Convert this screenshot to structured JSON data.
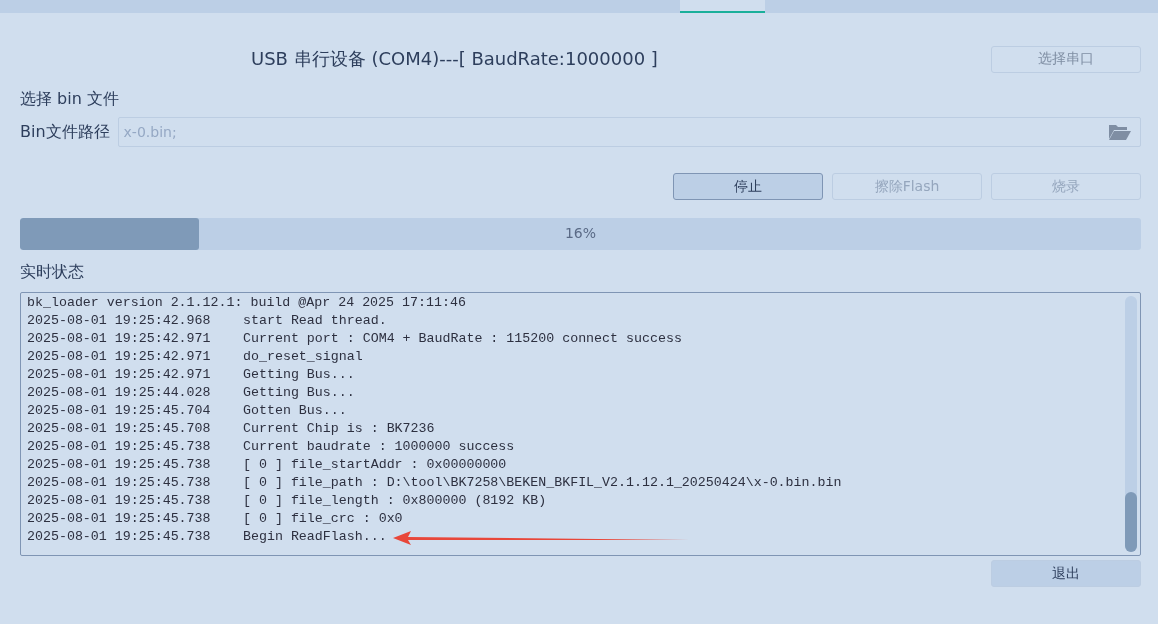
{
  "tabs": [
    {
      "selected": false
    },
    {
      "selected": true
    },
    {
      "selected": false
    }
  ],
  "device": {
    "title": "USB 串行设备 (COM4)---[ BaudRate:1000000 ]",
    "button": "选择串口"
  },
  "bin_section": {
    "heading": "选择 bin 文件",
    "path_label": "Bin文件路径",
    "path_value": "x-0.bin;"
  },
  "actions": [
    {
      "label": "停止",
      "disabled": false
    },
    {
      "label": "擦除Flash",
      "disabled": true
    },
    {
      "label": "烧录",
      "disabled": true
    }
  ],
  "progress": {
    "level": 0.16,
    "text": "16%"
  },
  "status": {
    "heading": "实时状态",
    "header_line": "bk_loader version 2.1.12.1: build @Apr 24 2025 17:11:46",
    "entries": [
      {
        "time": "2025-08-01 19:25:42.968",
        "message": "start Read thread."
      },
      {
        "time": "2025-08-01 19:25:42.971",
        "message": "Current port : COM4 + BaudRate : 115200 connect success"
      },
      {
        "time": "2025-08-01 19:25:42.971",
        "message": "do_reset_signal"
      },
      {
        "time": "2025-08-01 19:25:42.971",
        "message": "Getting Bus..."
      },
      {
        "time": "2025-08-01 19:25:44.028",
        "message": "Getting Bus..."
      },
      {
        "time": "2025-08-01 19:25:45.704",
        "message": "Gotten Bus..."
      },
      {
        "time": "2025-08-01 19:25:45.708",
        "message": "Current Chip is : BK7236"
      },
      {
        "time": "2025-08-01 19:25:45.738",
        "message": "Current baudrate : 1000000 success"
      },
      {
        "time": "2025-08-01 19:25:45.738",
        "message": "[ 0 ] file_startAddr : 0x00000000"
      },
      {
        "time": "2025-08-01 19:25:45.738",
        "message": "[ 0 ] file_path : D:\\tool\\BK7258\\BEKEN_BKFIL_V2.1.12.1_20250424\\x-0.bin.bin"
      },
      {
        "time": "2025-08-01 19:25:45.738",
        "message": "[ 0 ] file_length : 0x800000 (8192 KB)"
      },
      {
        "time": "2025-08-01 19:25:45.738",
        "message": "[ 0 ] file_crc : 0x0"
      },
      {
        "time": "2025-08-01 19:25:45.738",
        "message": "Begin ReadFlash..."
      }
    ]
  },
  "exit_button": "退出"
}
